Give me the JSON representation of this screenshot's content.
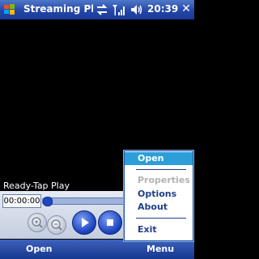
{
  "titlebar": {
    "app_title": "Streaming Playe",
    "time": "20:39",
    "close_label": "✕"
  },
  "video": {
    "status_text": "Ready-Tap Play",
    "elapsed_time": "00:00:00",
    "progress": 0
  },
  "controls": {
    "zoom_in_icon": "zoom-in-icon",
    "zoom_out_icon": "zoom-out-icon",
    "play_icon": "play-icon",
    "stop_icon": "stop-icon"
  },
  "menu": {
    "items": [
      {
        "label": "Open",
        "state": "selected"
      },
      {
        "label": "Properties",
        "state": "disabled"
      },
      {
        "label": "Options",
        "state": "enabled"
      },
      {
        "label": "About",
        "state": "enabled"
      },
      {
        "label": "Exit",
        "state": "enabled"
      }
    ]
  },
  "softkeys": {
    "left": "Open",
    "right": "Menu"
  },
  "colors": {
    "titlebar": "#2346a8",
    "menu_highlight": "#2c9fd8",
    "menu_text": "#1f3f8a"
  }
}
